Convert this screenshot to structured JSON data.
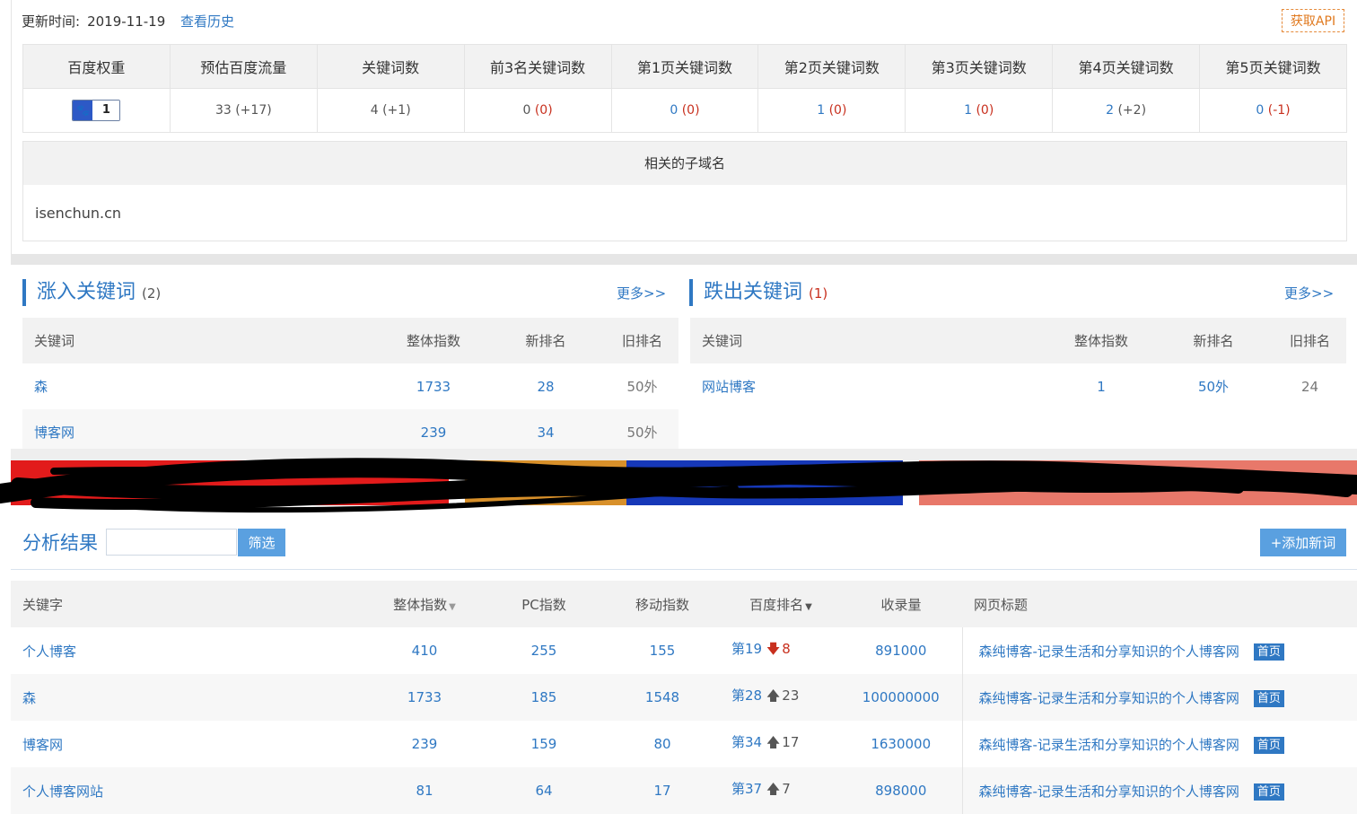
{
  "update": {
    "label": "更新时间:",
    "date": "2019-11-19",
    "history_link": "查看历史"
  },
  "api_button": "获取API",
  "stats": {
    "headers": [
      "百度权重",
      "预估百度流量",
      "关键词数",
      "前3名关键词数",
      "第1页关键词数",
      "第2页关键词数",
      "第3页关键词数",
      "第4页关键词数",
      "第5页关键词数"
    ],
    "weight": "1",
    "cells": [
      {
        "main": "33",
        "delta": "(+17)"
      },
      {
        "main": "4",
        "delta": "(+1)"
      },
      {
        "main": "0",
        "delta": "(0)"
      },
      {
        "main": "0",
        "delta": "(0)"
      },
      {
        "main": "1",
        "delta": "(0)"
      },
      {
        "main": "1",
        "delta": "(0)"
      },
      {
        "main": "2",
        "delta": "(+2)"
      },
      {
        "main": "0",
        "delta": "(-1)"
      }
    ]
  },
  "subdomain": {
    "header": "相关的子域名",
    "item": "isenchun.cn"
  },
  "rising": {
    "title": "涨入关键词",
    "count": "(2)",
    "more": "更多>>",
    "headers": [
      "关键词",
      "整体指数",
      "新排名",
      "旧排名"
    ],
    "rows": [
      [
        "森",
        "1733",
        "28",
        "50外"
      ],
      [
        "博客网",
        "239",
        "34",
        "50外"
      ]
    ]
  },
  "falling": {
    "title": "跌出关键词",
    "count": "(1)",
    "more": "更多>>",
    "headers": [
      "关键词",
      "整体指数",
      "新排名",
      "旧排名"
    ],
    "rows": [
      [
        "网站博客",
        "1",
        "50外",
        "24"
      ]
    ]
  },
  "analysis": {
    "title": "分析结果",
    "filter_placeholder": "",
    "filter_button": "筛选",
    "add_button": "+添加新词",
    "headers": {
      "keyword": "关键字",
      "overall": "整体指数",
      "pc": "PC指数",
      "mobile": "移动指数",
      "rank": "百度排名",
      "indexed": "收录量",
      "title": "网页标题"
    },
    "rows": [
      {
        "keyword": "个人博客",
        "overall": "410",
        "pc": "255",
        "mobile": "155",
        "rank": "第19",
        "dir": "down",
        "delta": "8",
        "indexed": "891000",
        "title": "森纯博客-记录生活和分享知识的个人博客网",
        "badge": "首页"
      },
      {
        "keyword": "森",
        "overall": "1733",
        "pc": "185",
        "mobile": "1548",
        "rank": "第28",
        "dir": "up",
        "delta": "23",
        "indexed": "100000000",
        "title": "森纯博客-记录生活和分享知识的个人博客网",
        "badge": "首页"
      },
      {
        "keyword": "博客网",
        "overall": "239",
        "pc": "159",
        "mobile": "80",
        "rank": "第34",
        "dir": "up",
        "delta": "17",
        "indexed": "1630000",
        "title": "森纯博客-记录生活和分享知识的个人博客网",
        "badge": "首页"
      },
      {
        "keyword": "个人博客网站",
        "overall": "81",
        "pc": "64",
        "mobile": "17",
        "rank": "第37",
        "dir": "up",
        "delta": "7",
        "indexed": "898000",
        "title": "森纯博客-记录生活和分享知识的个人博客网",
        "badge": "首页"
      }
    ]
  },
  "colors": {
    "accent": "#2f78c3",
    "delta_red": "#c8301e",
    "api_orange": "#e0791e",
    "button_blue": "#5aa0e0"
  }
}
